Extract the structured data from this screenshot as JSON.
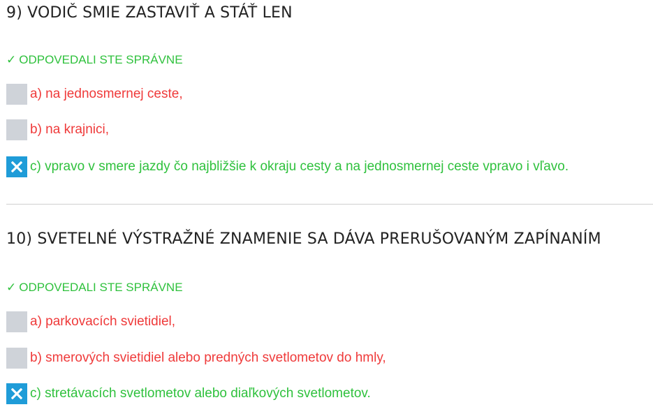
{
  "questions": [
    {
      "title": "9) VODIČ SMIE ZASTAVIŤ A STÁŤ LEN",
      "status_check": "✓",
      "status_text": "ODPOVEDALI STE SPRÁVNE",
      "answers": [
        {
          "text": "a) na jednosmernej ceste,",
          "checked": false,
          "correct": false
        },
        {
          "text": "b) na krajnici,",
          "checked": false,
          "correct": false
        },
        {
          "text": "c) vpravo v smere jazdy čo najbližšie k okraju cesty a na jednosmernej ceste vpravo i vľavo.",
          "checked": true,
          "correct": true
        }
      ]
    },
    {
      "title": "10) SVETELNÉ VÝSTRAŽNÉ ZNAMENIE SA DÁVA PRERUŠOVANÝM ZAPÍNANÍM",
      "status_check": "✓",
      "status_text": "ODPOVEDALI STE SPRÁVNE",
      "answers": [
        {
          "text": "a) parkovacích svietidiel,",
          "checked": false,
          "correct": false
        },
        {
          "text": "b) smerových svietidiel alebo predných svetlometov do hmly,",
          "checked": false,
          "correct": false
        },
        {
          "text": "c) stretávacích svetlometov alebo diaľkových svetlometov.",
          "checked": true,
          "correct": true
        }
      ]
    }
  ],
  "colors": {
    "correct": "#2fc13d",
    "wrong": "#ef3a3a",
    "checkbox_checked": "#1f9cd8",
    "checkbox_unchecked": "#cfd3d9"
  },
  "icons": {
    "status": "checkmark-icon",
    "checked_box": "close-x-icon"
  }
}
